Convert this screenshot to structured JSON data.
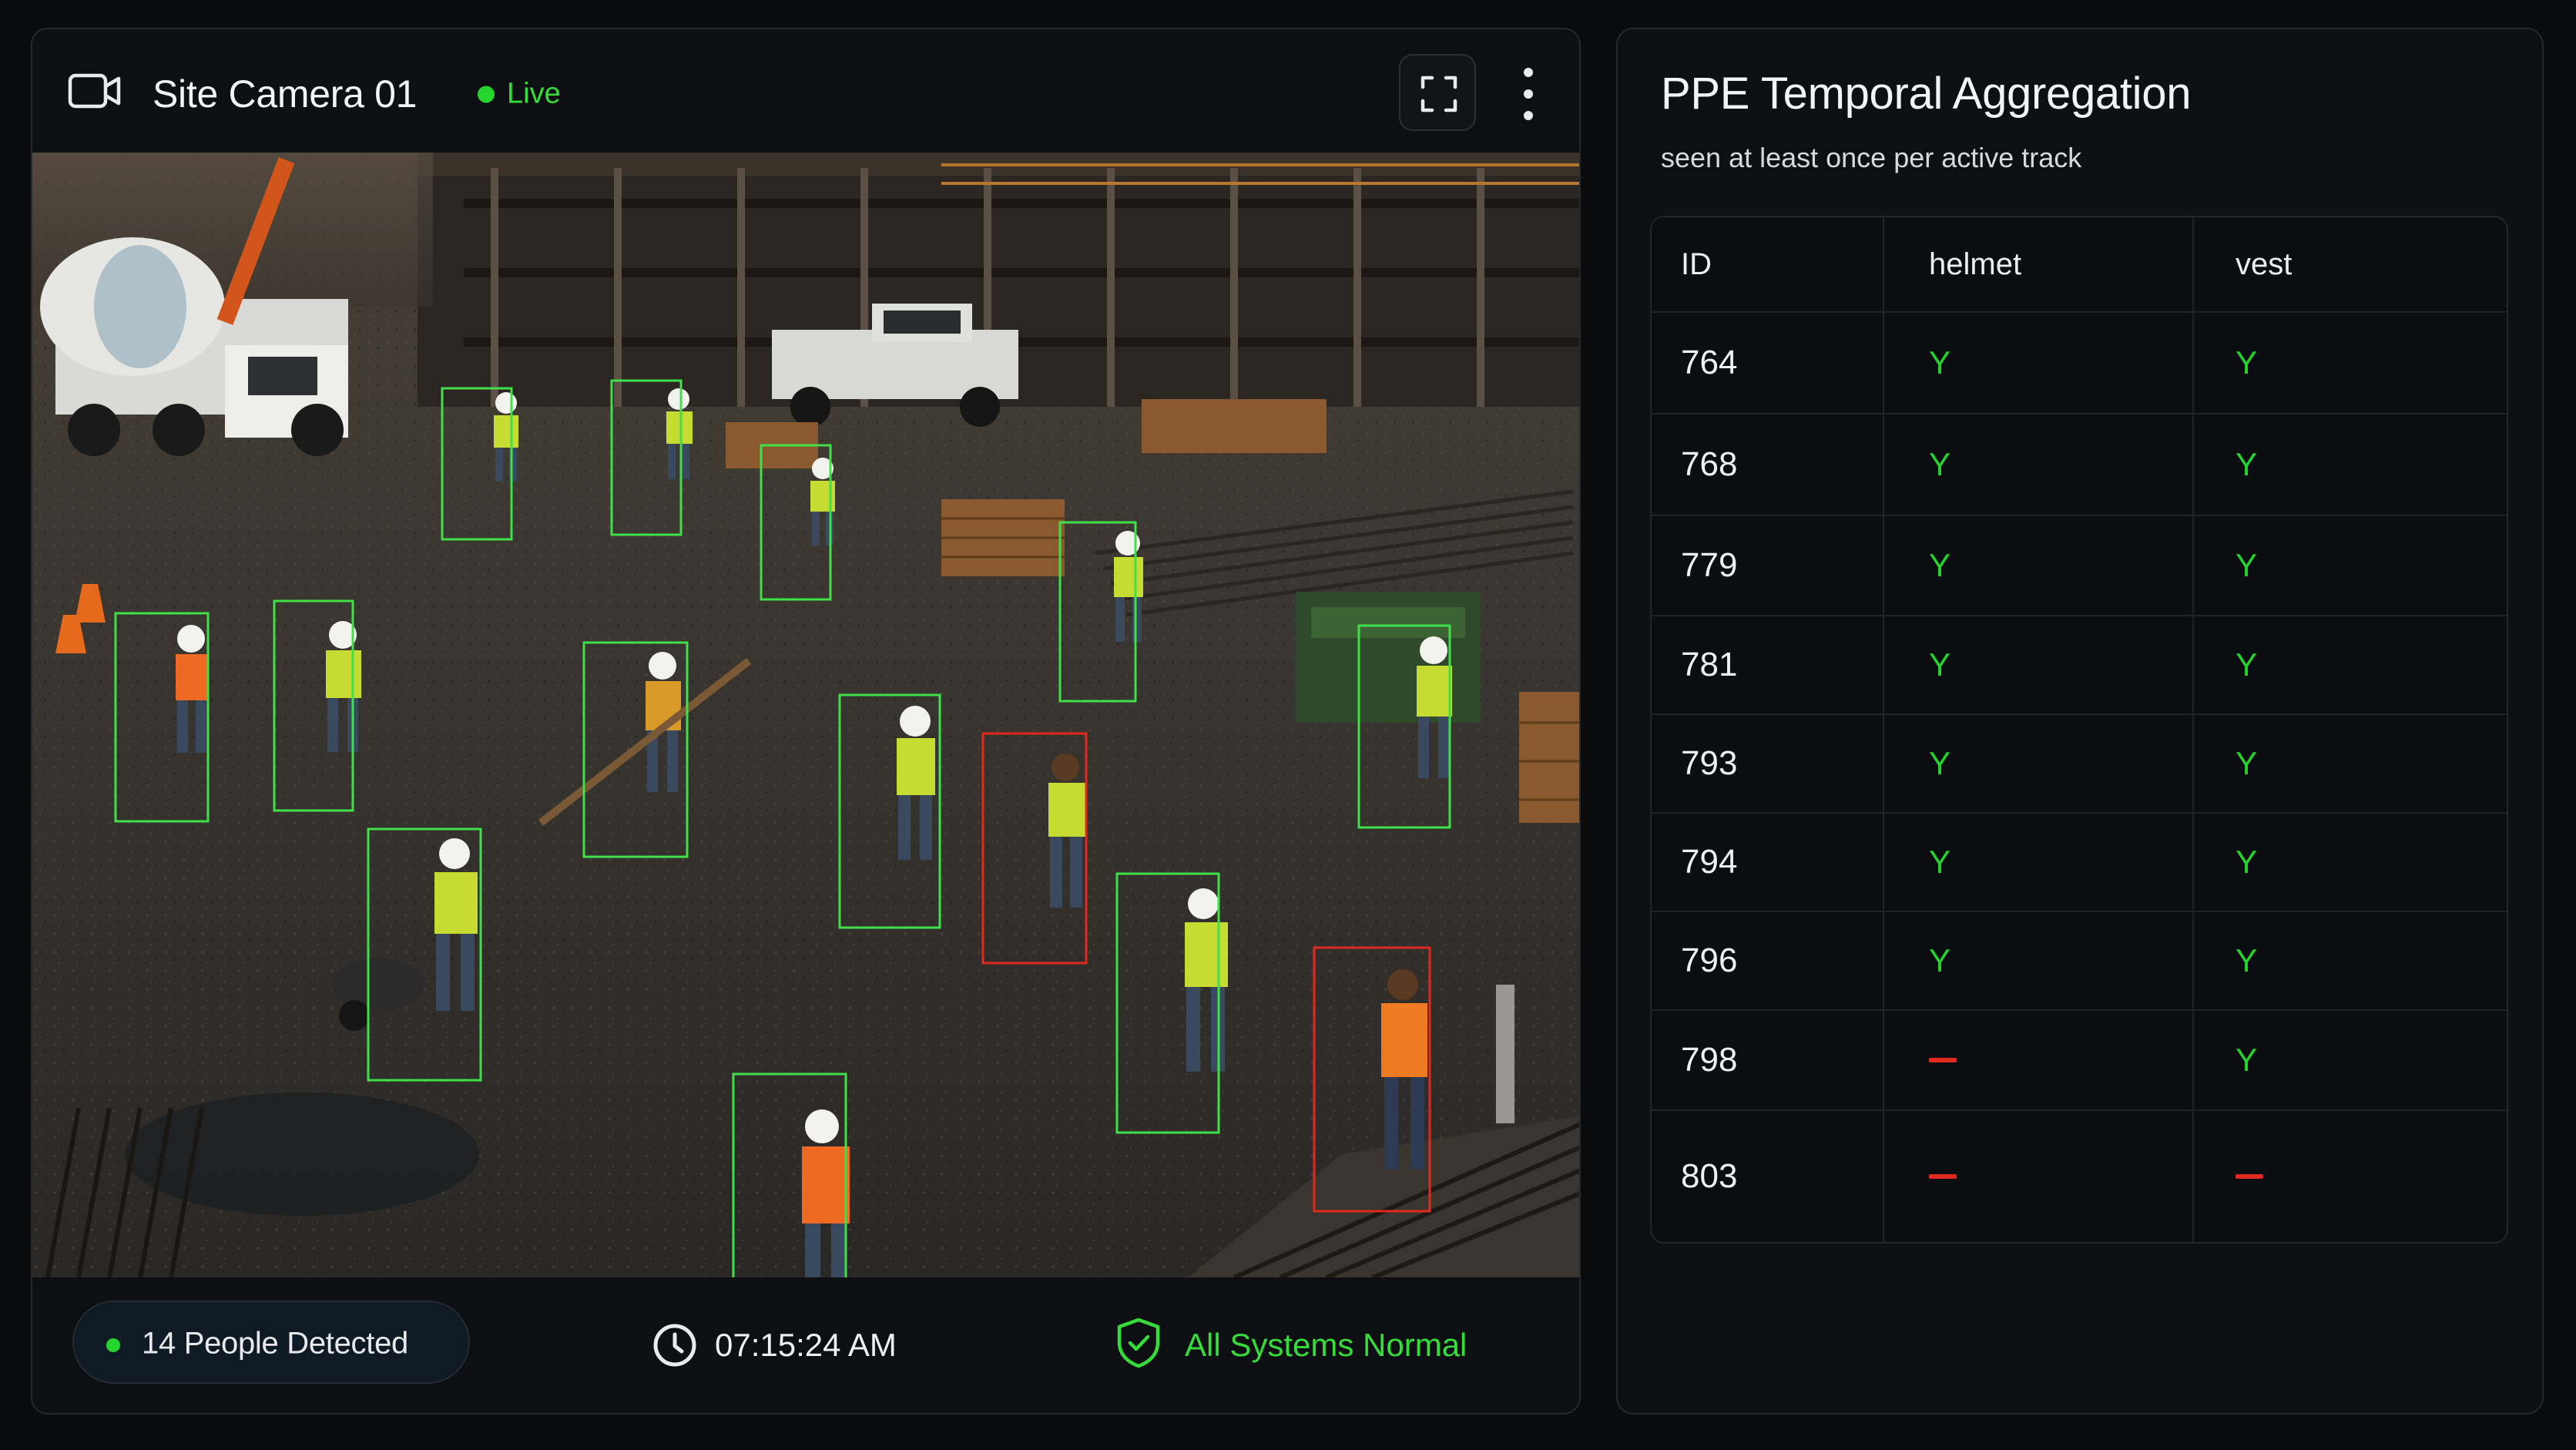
{
  "camera": {
    "title": "Site Camera 01",
    "live_label": "Live",
    "icons": {
      "camera": "video-camera-icon",
      "fullscreen": "fullscreen-icon",
      "more": "more-vertical-icon"
    }
  },
  "scene": {
    "description_icon": "construction-site-feed",
    "detections": [
      {
        "status": "ok"
      },
      {
        "status": "ok"
      },
      {
        "status": "ok"
      },
      {
        "status": "ok"
      },
      {
        "status": "ok"
      },
      {
        "status": "ok"
      },
      {
        "status": "ok"
      },
      {
        "status": "ok"
      },
      {
        "status": "ok"
      },
      {
        "status": "ok"
      },
      {
        "status": "violation"
      },
      {
        "status": "ok"
      },
      {
        "status": "violation"
      },
      {
        "status": "ok"
      }
    ]
  },
  "footer": {
    "people_detected": "14 People Detected",
    "time": "07:15:24 AM",
    "status": "All Systems Normal"
  },
  "ppe": {
    "title": "PPE Temporal Aggregation",
    "subtitle": "seen at least once per active track",
    "columns": [
      "ID",
      "helmet",
      "vest"
    ],
    "rows": [
      {
        "id": "764",
        "helmet": "Y",
        "vest": "Y"
      },
      {
        "id": "768",
        "helmet": "Y",
        "vest": "Y"
      },
      {
        "id": "779",
        "helmet": "Y",
        "vest": "Y"
      },
      {
        "id": "781",
        "helmet": "Y",
        "vest": "Y"
      },
      {
        "id": "793",
        "helmet": "Y",
        "vest": "Y"
      },
      {
        "id": "794",
        "helmet": "Y",
        "vest": "Y"
      },
      {
        "id": "796",
        "helmet": "Y",
        "vest": "Y"
      },
      {
        "id": "798",
        "helmet": "—",
        "vest": "Y"
      },
      {
        "id": "803",
        "helmet": "—",
        "vest": "—"
      }
    ]
  },
  "colors": {
    "ok": "#3fe04a",
    "violation": "#e0291f",
    "accent_green": "#35dc3a",
    "background": "#0a0b0d"
  }
}
